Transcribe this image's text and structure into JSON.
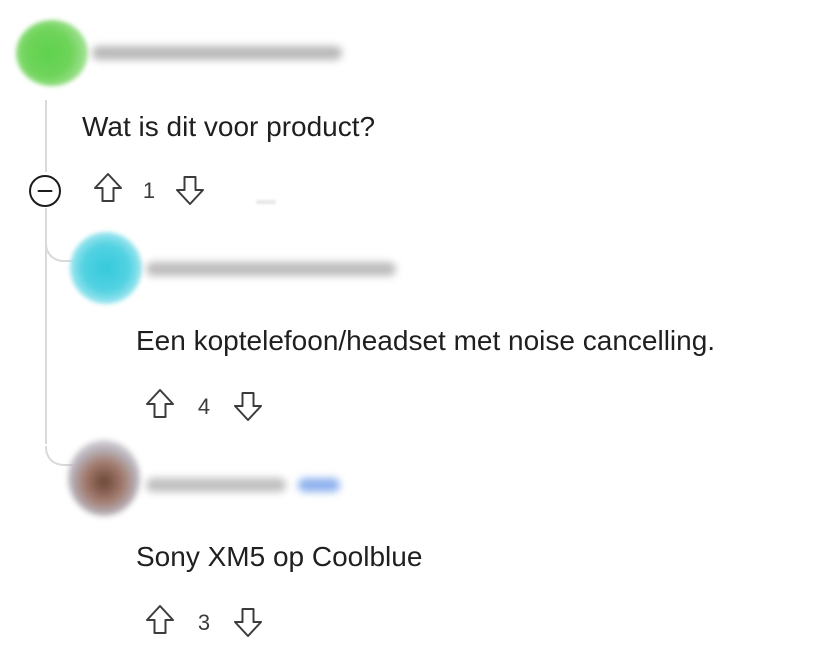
{
  "comments": [
    {
      "body": "Wat is dit voor product?",
      "score": "1"
    },
    {
      "body": "Een koptelefoon/headset met noise cancelling.",
      "score": "4"
    },
    {
      "body": "Sony XM5 op Coolblue",
      "score": "3"
    }
  ],
  "icons": {
    "collapse": "minus-circle-icon",
    "upvote": "arrow-up-icon",
    "downvote": "arrow-down-icon"
  },
  "colors": {
    "text": "#1f1f1f",
    "icon": "#3c3c3c",
    "thread_line": "#d9d9d9"
  }
}
